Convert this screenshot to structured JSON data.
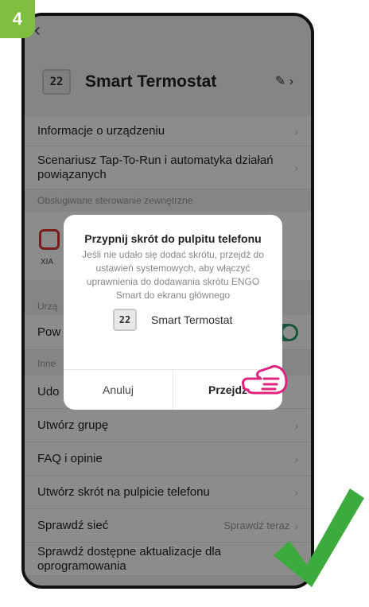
{
  "step": "4",
  "device": {
    "name": "Smart Termostat",
    "display_digits": "22"
  },
  "rows": {
    "info": "Informacje o urządzeniu",
    "scenario": "Scenariusz Tap-To-Run i automatyka działań powiązanych",
    "external_section": "Obsługiwane sterowanie zewnętrzne",
    "ext_tile": "XIA",
    "device_section": "Urzą",
    "power": "Pow",
    "other_section": "Inne",
    "share": "Udo",
    "group": "Utwórz grupę",
    "faq": "FAQ i opinie",
    "shortcut": "Utwórz skrót na pulpicie telefonu",
    "network": "Sprawdź sieć",
    "network_value": "Sprawdź teraz",
    "update": "Sprawdź dostępne aktualizacje dla oprogramowania"
  },
  "dialog": {
    "title": "Przypnij skrót do pulpitu telefonu",
    "body": "Jeśli nie udało się dodać skrótu, przejdź do ustawień systemowych, aby włączyć uprawnienia do dodawania skrótu ENGO Smart do ekranu głównego",
    "device_name": "Smart Termostat",
    "cancel": "Anuluj",
    "confirm": "Przejdź"
  },
  "colors": {
    "accent_green": "#7fbf3f",
    "toggle_green": "#2d9a6a",
    "hand_pink": "#e0237d",
    "check_green": "#3caa3c"
  }
}
